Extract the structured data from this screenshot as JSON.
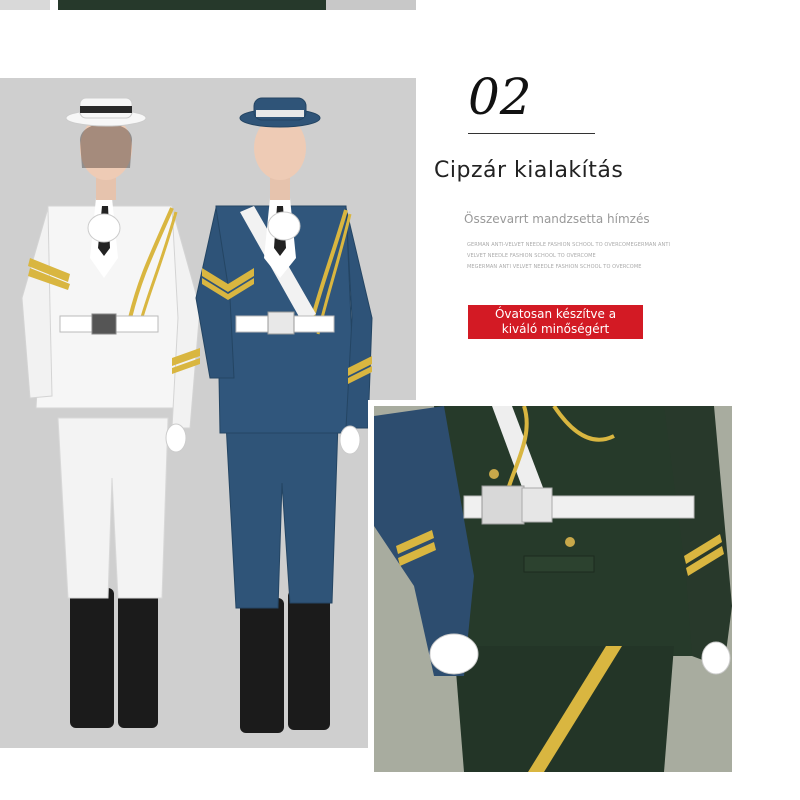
{
  "section": {
    "number": "02",
    "headline": "Cipzár kialakítás",
    "subline": "Összevarrt mandzsetta hímzés",
    "fine_print": [
      "GERMAN ANTI-VELVET NEEDLE FASHION SCHOOL TO OVERCOMEGERMAN ANTI",
      "VELVET NEEDLE FASHION SCHOOL TO OVERCOME",
      "MEGERMAN ANTI VELVET NEEDLE FASHION SCHOOL TO OVERCOME"
    ],
    "cta_line1": "Óvatosan készítve a",
    "cta_line2": "kiváló minőségért"
  },
  "colors": {
    "cta_bg": "#d31a24",
    "uniform_white": "#f4f4f4",
    "uniform_blue": "#2f5478",
    "uniform_green": "#27392b",
    "gold": "#d9b640"
  }
}
